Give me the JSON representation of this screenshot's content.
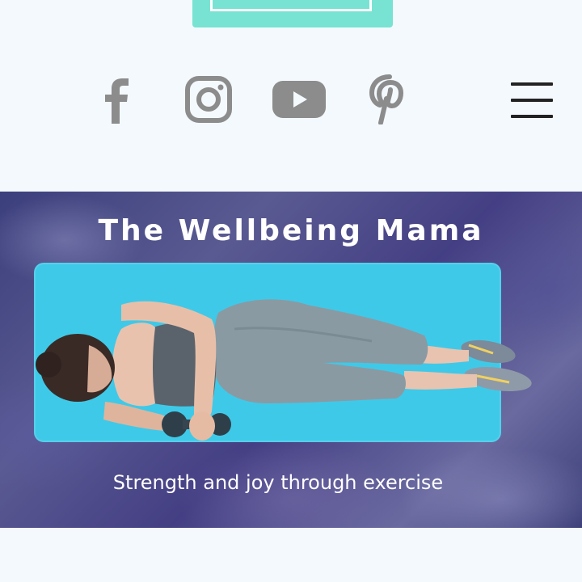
{
  "social": {
    "icons": [
      "facebook-icon",
      "instagram-icon",
      "youtube-icon",
      "pinterest-icon"
    ],
    "icon_color": "#8c8c8c"
  },
  "menu": {
    "icon": "hamburger-menu-icon"
  },
  "hero": {
    "title": "The Wellbeing Mama",
    "tagline": "Strength and joy through exercise",
    "mat_color": "#3fc9e8",
    "background_color": "#4a4c8a"
  },
  "logo": {
    "color": "#78e3d2"
  }
}
